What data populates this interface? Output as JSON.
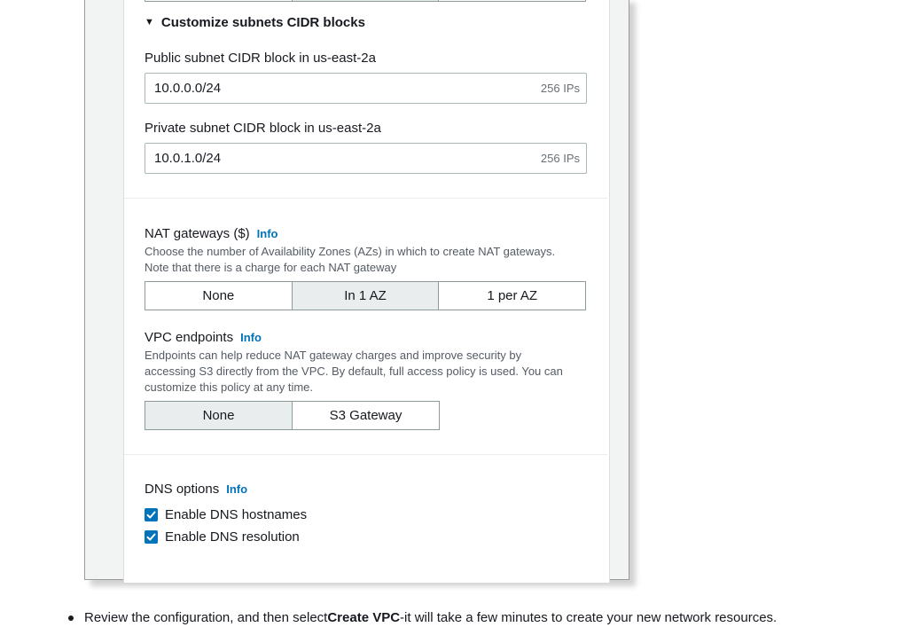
{
  "subnets": {
    "section_title": "Customize subnets CIDR blocks",
    "public_label": "Public subnet CIDR block in us-east-2a",
    "public_value": "10.0.0.0/24",
    "public_suffix": "256 IPs",
    "private_label": "Private subnet CIDR block in us-east-2a",
    "private_value": "10.0.1.0/24",
    "private_suffix": "256 IPs"
  },
  "nat": {
    "label": "NAT gateways ($)",
    "info": "Info",
    "desc_line1": "Choose the number of Availability Zones (AZs) in which to create NAT gateways.",
    "desc_line2": "Note that there is a charge for each NAT gateway",
    "options": [
      "None",
      "In 1 AZ",
      "1 per AZ"
    ],
    "selected": "In 1 AZ"
  },
  "vpc_endpoints": {
    "label": "VPC endpoints",
    "info": "Info",
    "desc_line1": "Endpoints can help reduce NAT gateway charges and improve security by",
    "desc_line2": "accessing S3 directly from the VPC. By default, full access policy is used. You can",
    "desc_line3": "customize this policy at any time.",
    "options": [
      "None",
      "S3 Gateway"
    ],
    "selected": "None"
  },
  "dns": {
    "label": "DNS options",
    "info": "Info",
    "hostnames_label": "Enable DNS hostnames",
    "hostnames_checked": true,
    "resolution_label": "Enable DNS resolution",
    "resolution_checked": true
  },
  "instruction": {
    "prefix": "Review the configuration, and then select ",
    "bold": "Create VPC",
    "suffix": "-it will take a few minutes to create your new network resources."
  },
  "colors": {
    "accent": "#0073bb",
    "selected_segment": "#eaeded",
    "muted_text": "#687078"
  }
}
